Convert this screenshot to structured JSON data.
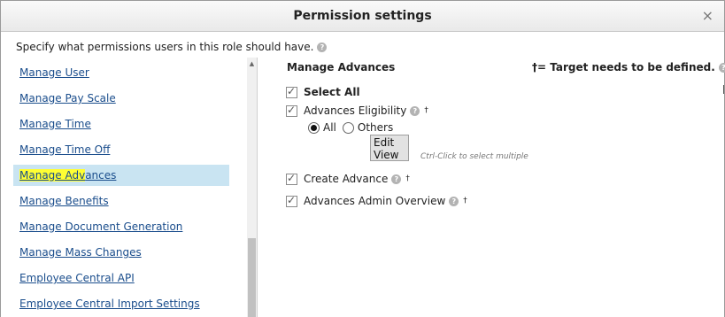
{
  "dialog": {
    "title": "Permission settings",
    "close_glyph": "×",
    "intro": "Specify what permissions users in this role should have.",
    "help_glyph": "?"
  },
  "nav": {
    "items": [
      {
        "label": "Manage User"
      },
      {
        "label": "Manage Pay Scale"
      },
      {
        "label": "Manage Time"
      },
      {
        "label": "Manage Time Off"
      },
      {
        "label_hl": "Manage Adv",
        "label_rest": "ances",
        "selected": true
      },
      {
        "label": "Manage Benefits"
      },
      {
        "label": "Manage Document Generation"
      },
      {
        "label": "Manage Mass Changes"
      },
      {
        "label": "Employee Central API"
      },
      {
        "label": "Employee Central Import Settings"
      }
    ]
  },
  "panel": {
    "section_title": "Manage Advances",
    "target_note": "†= Target needs to be defined.",
    "select_all": {
      "label": "Select All",
      "checked": true
    },
    "eligibility": {
      "label": "Advances Eligibility",
      "checked": true,
      "dagger": "†"
    },
    "radio_all": {
      "label": "All",
      "selected": true
    },
    "radio_others": {
      "label": "Others",
      "selected": false
    },
    "edit_view_line1": "Edit",
    "edit_view_line2": "View",
    "ctrl_hint": "Ctrl-Click to select multiple",
    "create_advance": {
      "label": "Create Advance",
      "checked": true,
      "dagger": "†"
    },
    "admin_overview": {
      "label": "Advances Admin Overview",
      "checked": true,
      "dagger": "†"
    }
  },
  "icons": {
    "checkmark": "✓",
    "scroll_up": "▲"
  }
}
